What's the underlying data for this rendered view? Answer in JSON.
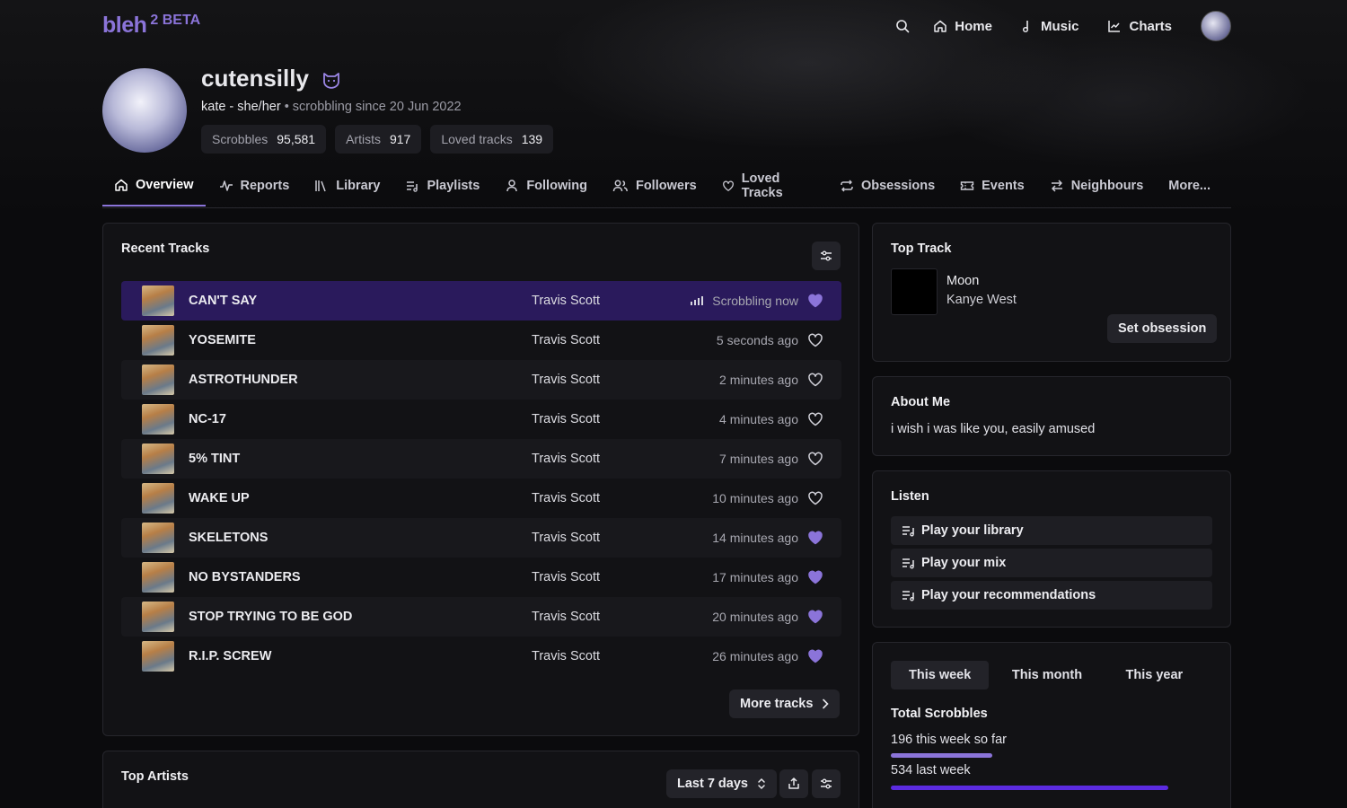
{
  "app": {
    "logo": "bleh",
    "logo_sup": "2 BETA"
  },
  "topnav": {
    "links": [
      {
        "label": "Home",
        "icon": "home-icon"
      },
      {
        "label": "Music",
        "icon": "music-note-icon"
      },
      {
        "label": "Charts",
        "icon": "chart-icon"
      }
    ]
  },
  "profile": {
    "name": "cutensilly",
    "subtitle_main": "kate - she/her",
    "subtitle_muted": " • scrobbling since 20 Jun 2022",
    "stats": [
      {
        "label": "Scrobbles",
        "value": "95,581"
      },
      {
        "label": "Artists",
        "value": "917"
      },
      {
        "label": "Loved tracks",
        "value": "139"
      }
    ]
  },
  "tabs": [
    {
      "label": "Overview",
      "icon": "home-icon",
      "active": true
    },
    {
      "label": "Reports",
      "icon": "pulse-icon"
    },
    {
      "label": "Library",
      "icon": "library-icon"
    },
    {
      "label": "Playlists",
      "icon": "playlist-icon"
    },
    {
      "label": "Following",
      "icon": "person-icon"
    },
    {
      "label": "Followers",
      "icon": "people-icon"
    },
    {
      "label": "Loved Tracks",
      "icon": "heart-icon"
    },
    {
      "label": "Obsessions",
      "icon": "repeat-icon"
    },
    {
      "label": "Events",
      "icon": "ticket-icon"
    },
    {
      "label": "Neighbours",
      "icon": "swap-icon"
    }
  ],
  "tabs_more": "More...",
  "recent": {
    "title": "Recent Tracks",
    "tracks": [
      {
        "name": "CAN'T SAY",
        "artist": "Travis Scott",
        "time": "Scrobbling now",
        "loved": true,
        "now": true
      },
      {
        "name": "YOSEMITE",
        "artist": "Travis Scott",
        "time": "5 seconds ago",
        "loved": false
      },
      {
        "name": "ASTROTHUNDER",
        "artist": "Travis Scott",
        "time": "2 minutes ago",
        "loved": false
      },
      {
        "name": "NC-17",
        "artist": "Travis Scott",
        "time": "4 minutes ago",
        "loved": false
      },
      {
        "name": "5% TINT",
        "artist": "Travis Scott",
        "time": "7 minutes ago",
        "loved": false
      },
      {
        "name": "WAKE UP",
        "artist": "Travis Scott",
        "time": "10 minutes ago",
        "loved": false
      },
      {
        "name": "SKELETONS",
        "artist": "Travis Scott",
        "time": "14 minutes ago",
        "loved": true
      },
      {
        "name": "NO BYSTANDERS",
        "artist": "Travis Scott",
        "time": "17 minutes ago",
        "loved": true
      },
      {
        "name": "STOP TRYING TO BE GOD",
        "artist": "Travis Scott",
        "time": "20 minutes ago",
        "loved": true
      },
      {
        "name": "R.I.P. SCREW",
        "artist": "Travis Scott",
        "time": "26 minutes ago",
        "loved": true
      }
    ],
    "more_label": "More tracks"
  },
  "top_artists": {
    "title": "Top Artists",
    "range": "Last 7 days"
  },
  "top_track": {
    "title": "Top Track",
    "name": "Moon",
    "artist": "Kanye West",
    "button": "Set obsession"
  },
  "about": {
    "title": "About Me",
    "text": "i wish i was like you, easily amused"
  },
  "listen": {
    "title": "Listen",
    "items": [
      "Play your library",
      "Play your mix",
      "Play your recommendations"
    ]
  },
  "scrobbles": {
    "periods": [
      "This week",
      "This month",
      "This year"
    ],
    "active_period": "This week",
    "title": "Total Scrobbles",
    "this_week": "196 this week so far",
    "last_week": "534 last week",
    "this_week_value": 196,
    "last_week_value": 534
  },
  "colors": {
    "accent": "#8b74d9",
    "now_playing_row": "#2a1a5c",
    "bar_this_week": "#8b74d9",
    "bar_last_week": "#5b2be0"
  }
}
